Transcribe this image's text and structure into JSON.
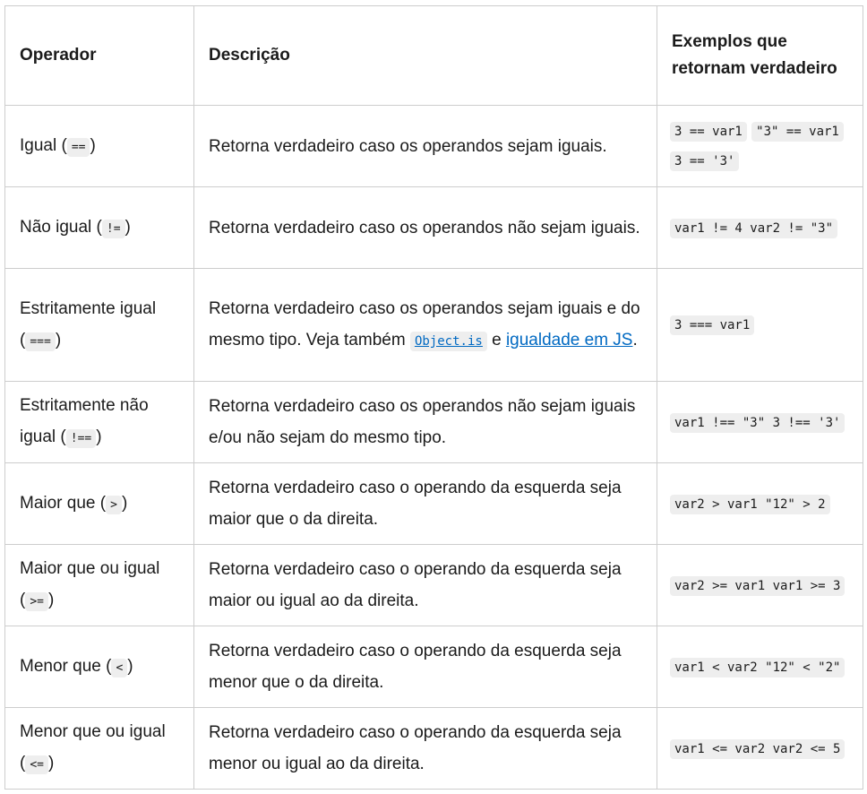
{
  "headers": {
    "operator": "Operador",
    "description": "Descrição",
    "examples": "Exemplos que retornam verdadeiro"
  },
  "rows": [
    {
      "name": "Igual",
      "symbol": "==",
      "description": "Retorna verdadeiro caso os operandos sejam iguais.",
      "examples": [
        "3 == var1",
        "\"3\" == var1",
        "3 == '3'"
      ]
    },
    {
      "name": "Não igual",
      "symbol": "!=",
      "description": "Retorna verdadeiro caso os operandos não sejam iguais.",
      "examples": [
        "var1 != 4 var2 != \"3\""
      ]
    },
    {
      "name": "Estritamente igual",
      "symbol": "===",
      "description_prefix": "Retorna verdadeiro caso os operandos sejam iguais e do mesmo tipo. Veja também",
      "link1": "Object.is",
      "description_mid": "e",
      "link2": "igualdade em JS",
      "description_suffix": ".",
      "examples": [
        "3 === var1"
      ]
    },
    {
      "name": "Estritamente não igual",
      "symbol": "!==",
      "description": "Retorna verdadeiro caso os operandos não sejam iguais e/ou não sejam do mesmo tipo.",
      "examples": [
        "var1 !== \"3\" 3 !== '3'"
      ]
    },
    {
      "name": "Maior que",
      "symbol": ">",
      "description": "Retorna verdadeiro caso o operando da esquerda seja maior que o da direita.",
      "examples": [
        "var2 > var1 \"12\" > 2"
      ]
    },
    {
      "name": "Maior que ou igual",
      "symbol": ">=",
      "description": "Retorna verdadeiro caso o operando da esquerda seja maior ou igual ao da direita.",
      "examples": [
        "var2 >= var1 var1 >= 3"
      ]
    },
    {
      "name": "Menor que",
      "symbol": "<",
      "description": "Retorna verdadeiro caso o operando da esquerda seja menor que o da direita.",
      "examples": [
        "var1 < var2 \"12\" < \"2\""
      ]
    },
    {
      "name": "Menor que ou igual",
      "symbol": "<=",
      "description": "Retorna verdadeiro caso o operando da esquerda seja menor ou igual ao da direita.",
      "examples": [
        "var1 <= var2 var2 <= 5"
      ]
    }
  ]
}
